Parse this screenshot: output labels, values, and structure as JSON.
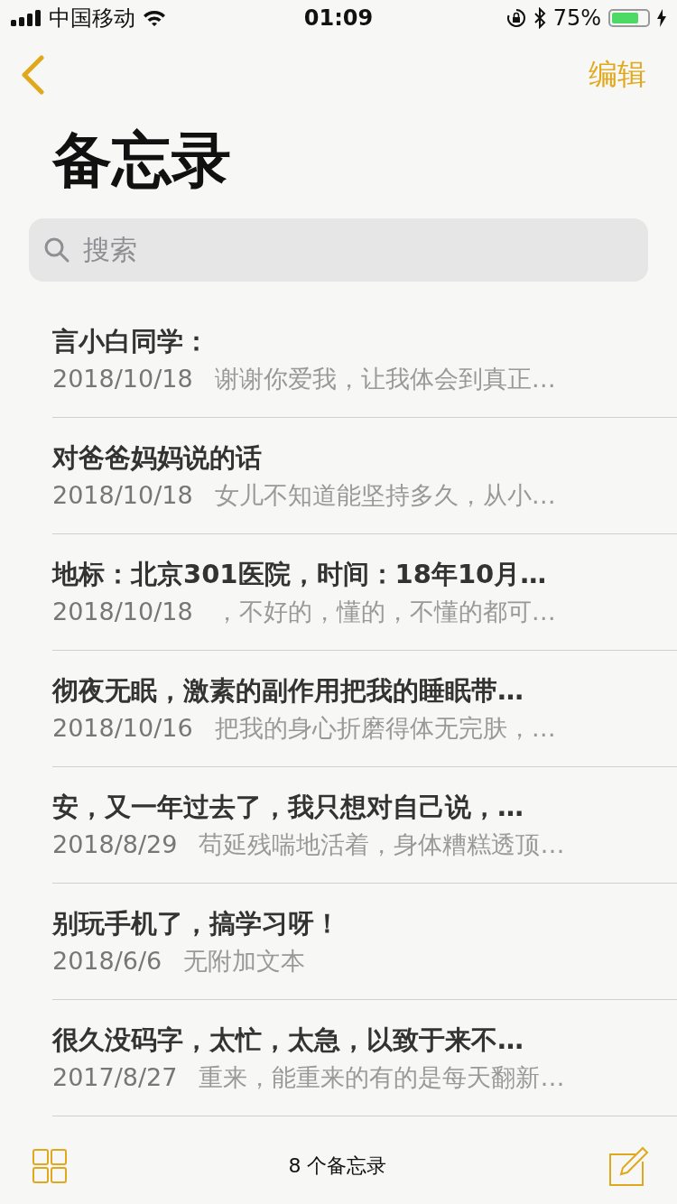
{
  "status_bar": {
    "carrier": "中国移动",
    "time": "01:09",
    "battery": "75%"
  },
  "nav": {
    "edit": "编辑"
  },
  "title": "备忘录",
  "search": {
    "placeholder": "搜索"
  },
  "notes": [
    {
      "title": "言小白同学：",
      "date": "2018/10/18",
      "preview": "谢谢你爱我，让我体会到真正…"
    },
    {
      "title": "对爸爸妈妈说的话",
      "date": "2018/10/18",
      "preview": "女儿不知道能坚持多久，从小…"
    },
    {
      "title": "地标：北京301医院，时间：18年10月…",
      "date": "2018/10/18",
      "preview": "，不好的，懂的，不懂的都可…"
    },
    {
      "title": "彻夜无眠，激素的副作用把我的睡眠带…",
      "date": "2018/10/16",
      "preview": "把我的身心折磨得体无完肤，…"
    },
    {
      "title": "安，又一年过去了，我只想对自己说，…",
      "date": "2018/8/29",
      "preview": "苟延残喘地活着，身体糟糕透顶…"
    },
    {
      "title": "别玩手机了，搞学习呀！",
      "date": "2018/6/6",
      "preview": "无附加文本"
    },
    {
      "title": "很久没码字，太忙，太急，以致于来不…",
      "date": "2017/8/27",
      "preview": "重来，能重来的有的是每天翻新…"
    }
  ],
  "toolbar": {
    "count": "8 个备忘录"
  }
}
